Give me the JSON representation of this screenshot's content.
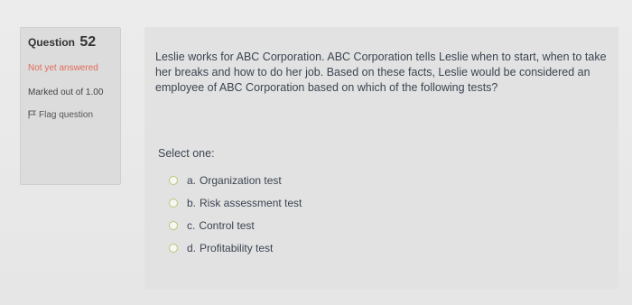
{
  "question_info": {
    "label": "Question",
    "number": "52",
    "status": "Not yet answered",
    "marked_out_of": "Marked out of 1.00",
    "flag_label": "Flag question",
    "flag_icon": "flag-icon"
  },
  "question": {
    "text": "Leslie works for ABC Corporation. ABC Corporation tells Leslie when to start, when to take her breaks and how to do her job. Based on these facts, Leslie would be considered an employee of ABC Corporation based on which of the following tests?",
    "select_prompt": "Select one:",
    "options": [
      {
        "letter": "a.",
        "label": "Organization test"
      },
      {
        "letter": "b.",
        "label": "Risk assessment test"
      },
      {
        "letter": "c.",
        "label": "Control test"
      },
      {
        "letter": "d.",
        "label": "Profitability test"
      }
    ]
  },
  "colors": {
    "status": "#e36b5a",
    "radio_border": "#b9c77a"
  }
}
